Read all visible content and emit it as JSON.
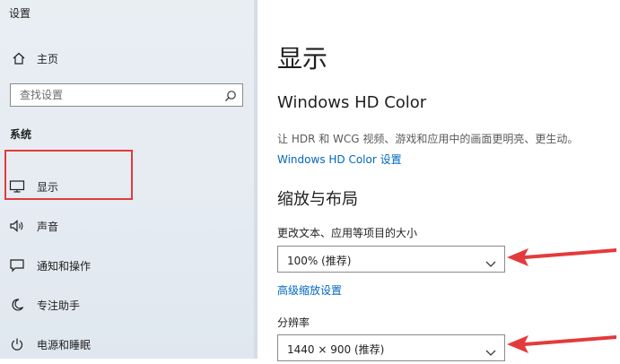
{
  "window": {
    "title": "设置"
  },
  "sidebar": {
    "home_label": "主页",
    "search_placeholder": "查找设置",
    "section_label": "系统",
    "items": [
      {
        "label": "显示",
        "icon": "monitor-icon"
      },
      {
        "label": "声音",
        "icon": "speaker-icon"
      },
      {
        "label": "通知和操作",
        "icon": "notification-icon"
      },
      {
        "label": "专注助手",
        "icon": "moon-icon"
      },
      {
        "label": "电源和睡眠",
        "icon": "power-icon"
      }
    ]
  },
  "main": {
    "title": "显示",
    "hd_color": {
      "heading": "Windows HD Color",
      "description": "让 HDR 和 WCG 视频、游戏和应用中的画面更明亮、更生动。",
      "link": "Windows HD Color 设置"
    },
    "scale_layout": {
      "heading": "缩放与布局",
      "text_size_label": "更改文本、应用等项目的大小",
      "text_size_value": "100% (推荐)",
      "advanced_link": "高级缩放设置",
      "resolution_label": "分辨率",
      "resolution_value": "1440 × 900 (推荐)"
    }
  },
  "colors": {
    "annotation_red": "#e33b3b",
    "link_blue": "#0067c0",
    "sidebar_bg": "#e7ecf2"
  }
}
